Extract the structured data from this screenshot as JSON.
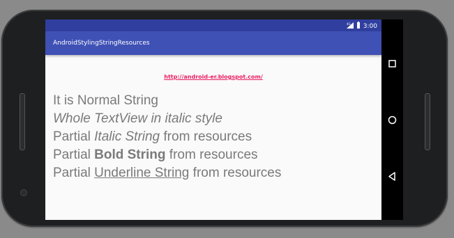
{
  "status": {
    "time": "3:00"
  },
  "appbar": {
    "title": "AndroidStylingStringResources"
  },
  "content": {
    "link": "http://android-er.blogspot.com/",
    "line1": "It is Normal String",
    "line2": "Whole TextView in italic style",
    "line3": {
      "pre": "Partial ",
      "styled": "Italic String",
      "post": " from resources"
    },
    "line4": {
      "pre": "Partial ",
      "styled": "Bold String",
      "post": " from resources"
    },
    "line5": {
      "pre": "Partial ",
      "styled": "Underline String",
      "post": " from resources"
    }
  },
  "navbar": {
    "icons": [
      "recents-icon",
      "home-icon",
      "back-icon"
    ]
  },
  "colors": {
    "statusbar": "#303f9f",
    "appbar": "#3f51b5",
    "link": "#e91e63",
    "text": "#7a7a7a"
  }
}
